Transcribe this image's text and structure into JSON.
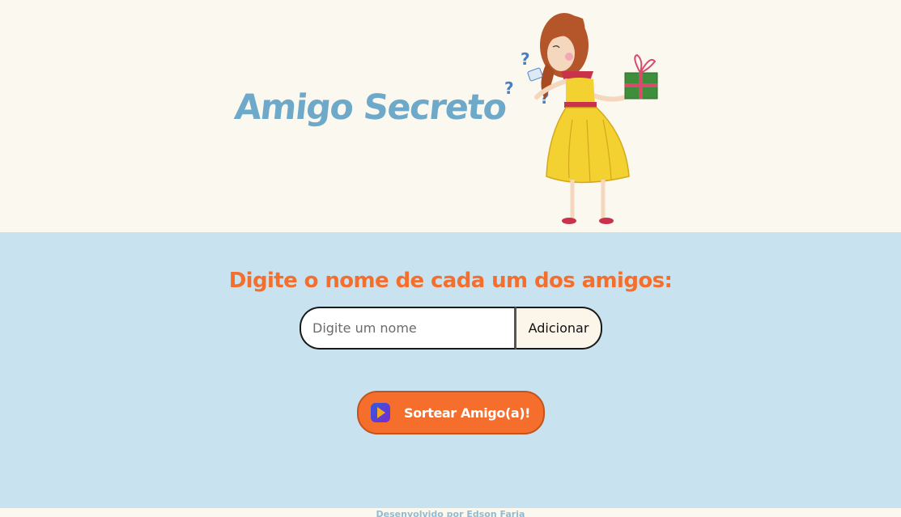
{
  "header": {
    "title": "Amigo Secreto",
    "illustration": "woman-holding-gift-icon"
  },
  "main": {
    "subtitle": "Digite o nome de cada um dos amigos:",
    "name_input": {
      "placeholder": "Digite um nome",
      "value": ""
    },
    "add_button_label": "Adicionar",
    "draw_button": {
      "label": "Sortear Amigo(a)!",
      "icon": "play-icon"
    }
  },
  "footer": {
    "credit": "Desenvolvido por Edson Faria"
  },
  "colors": {
    "header_bg": "#FBF8EF",
    "main_bg": "#C8E3EF",
    "title": "#6FA9C9",
    "subtitle": "#F56E2C",
    "draw_button_bg": "#F56E2C",
    "add_button_bg": "#FBF5EA"
  }
}
